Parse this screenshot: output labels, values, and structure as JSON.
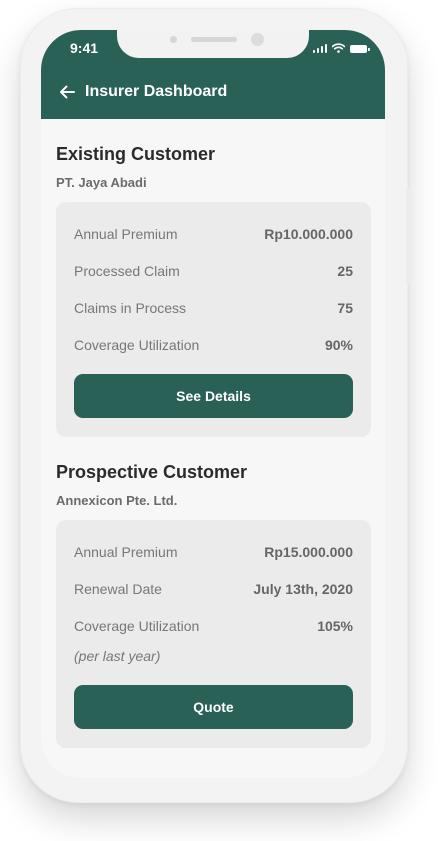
{
  "status_bar": {
    "time": "9:41"
  },
  "header": {
    "title": "Insurer Dashboard"
  },
  "existing": {
    "title": "Existing Customer",
    "company": "PT. Jaya Abadi",
    "rows": [
      {
        "label": "Annual Premium",
        "value": "Rp10.000.000"
      },
      {
        "label": "Processed Claim",
        "value": "25"
      },
      {
        "label": "Claims in Process",
        "value": "75"
      },
      {
        "label": "Coverage Utilization",
        "value": "90%"
      }
    ],
    "button": "See Details"
  },
  "prospective": {
    "title": "Prospective Customer",
    "company": "Annexicon Pte. Ltd.",
    "rows": [
      {
        "label": "Annual Premium",
        "value": "Rp15.000.000"
      },
      {
        "label": "Renewal Date",
        "value": "July 13th, 2020"
      },
      {
        "label": "Coverage Utilization",
        "value": "105%"
      }
    ],
    "note": "(per last year)",
    "button": "Quote"
  },
  "colors": {
    "primary": "#2a6156",
    "card": "#ebebeb",
    "background": "#f7f7f7"
  }
}
